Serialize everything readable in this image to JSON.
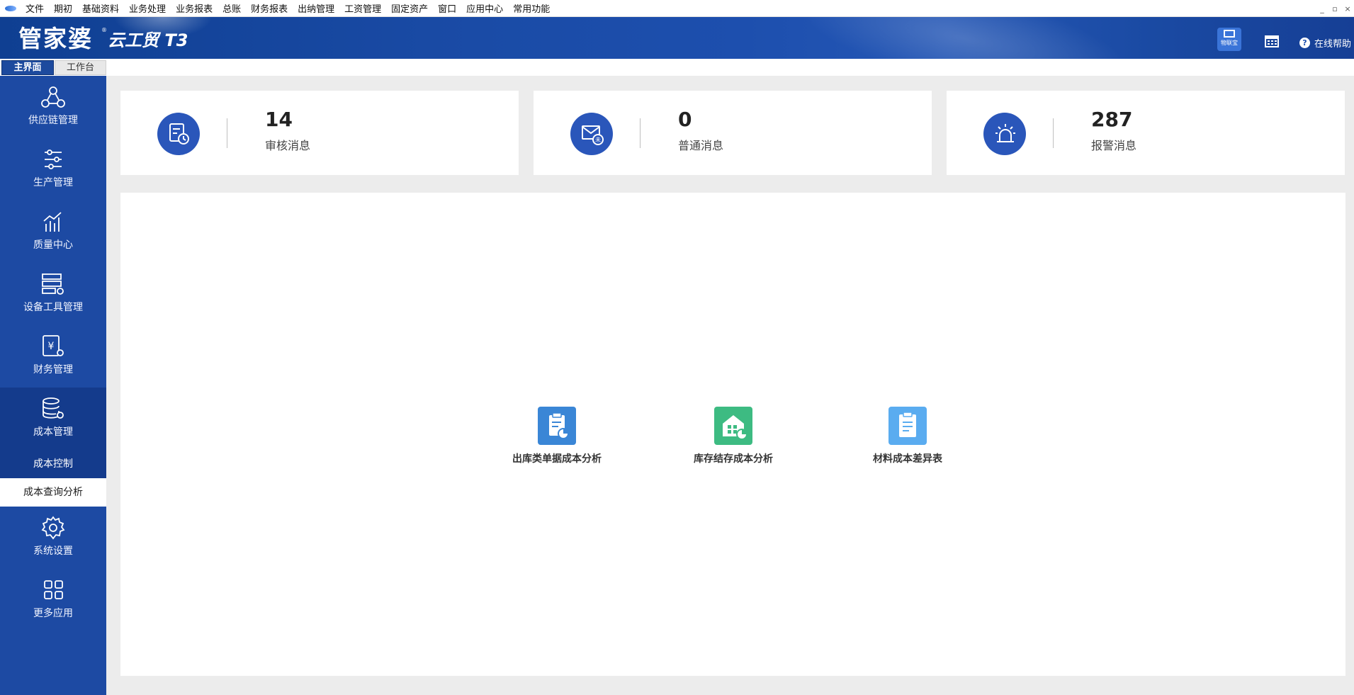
{
  "menubar": {
    "items": [
      "文件",
      "期初",
      "基础资料",
      "业务处理",
      "业务报表",
      "总账",
      "财务报表",
      "出纳管理",
      "工资管理",
      "固定资产",
      "窗口",
      "应用中心",
      "常用功能"
    ],
    "window_controls": [
      "_",
      "▫",
      "×"
    ]
  },
  "header": {
    "logo": "管家婆",
    "logo_sub": "云工贸 T3",
    "qr_label": "物联宝",
    "help_label": "在线帮助"
  },
  "tabs": {
    "main": "主界面",
    "workbench": "工作台"
  },
  "sidebar": {
    "items": [
      {
        "label": "供应链管理",
        "icon": "supply-chain-icon"
      },
      {
        "label": "生产管理",
        "icon": "sliders-icon"
      },
      {
        "label": "质量中心",
        "icon": "chart-trend-icon"
      },
      {
        "label": "设备工具管理",
        "icon": "server-gear-icon"
      },
      {
        "label": "财务管理",
        "icon": "finance-doc-icon"
      },
      {
        "label": "成本管理",
        "icon": "database-gear-icon"
      },
      {
        "label": "系统设置",
        "icon": "gear-icon"
      },
      {
        "label": "更多应用",
        "icon": "grid-icon"
      }
    ],
    "sub_items": [
      "成本控制",
      "成本查询分析"
    ]
  },
  "stats": [
    {
      "value": "14",
      "label": "审核消息",
      "icon": "review-doc-clock-icon"
    },
    {
      "value": "0",
      "label": "普通消息",
      "icon": "mail-unread-icon"
    },
    {
      "value": "287",
      "label": "报警消息",
      "icon": "alarm-light-icon"
    }
  ],
  "tiles": [
    {
      "label": "出库类单据成本分析",
      "icon": "clipboard-pie-icon",
      "color": "#3a86d6"
    },
    {
      "label": "库存结存成本分析",
      "icon": "warehouse-pie-icon",
      "color": "#3dbb82"
    },
    {
      "label": "材料成本差异表",
      "icon": "clipboard-list-icon",
      "color": "#5aacf0"
    }
  ],
  "colors": {
    "sidebar": "#1d4aa3",
    "sidebar_selected": "#143b8c",
    "stat_icon": "#2a56ba",
    "header": "#1a4ba6"
  }
}
